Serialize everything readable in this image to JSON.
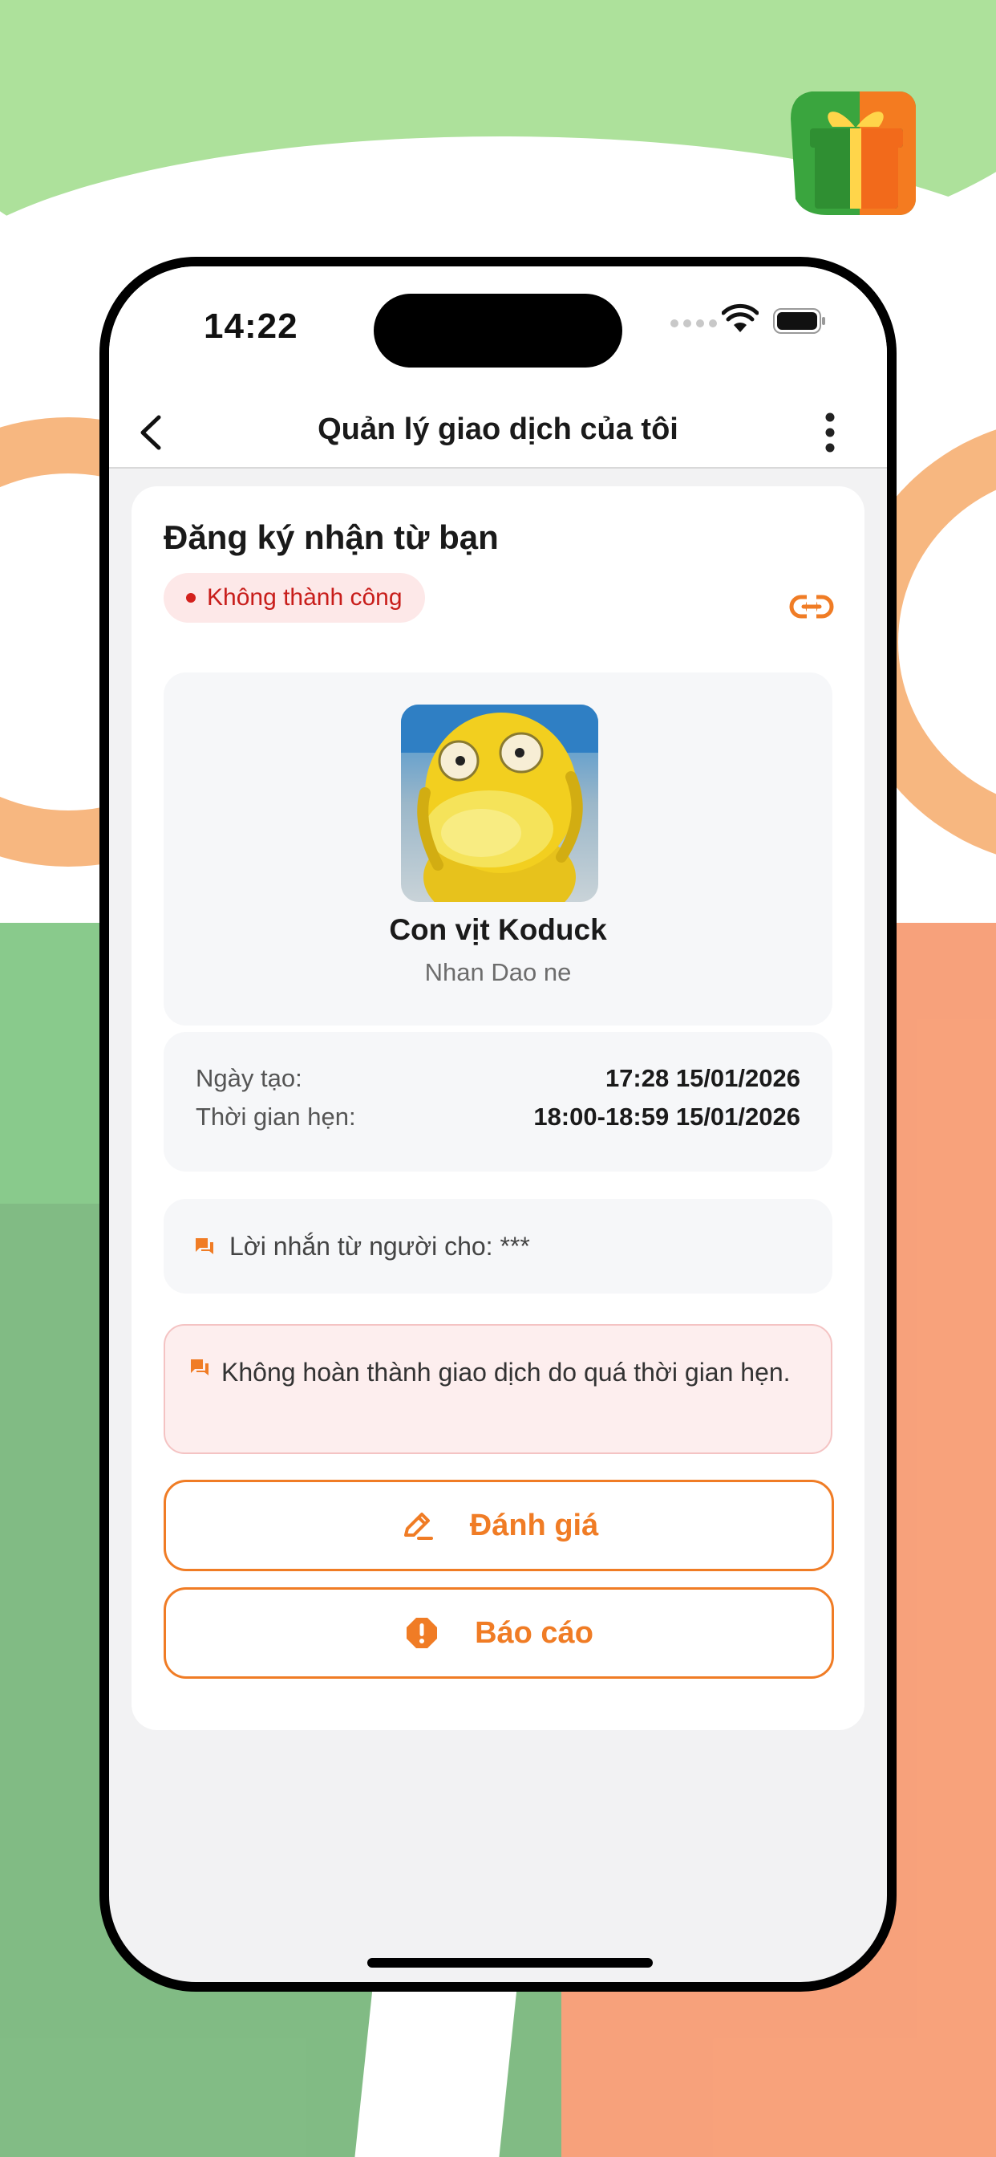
{
  "status_bar": {
    "time": "14:22"
  },
  "header": {
    "title": "Quản lý giao dịch của tôi"
  },
  "card": {
    "title": "Đăng ký nhận từ bạn",
    "status": "Không thành công"
  },
  "product": {
    "name": "Con vịt Koduck",
    "owner": "Nhan Dao ne"
  },
  "details": {
    "created_label": "Ngày tạo:",
    "created_value": "17:28 15/01/2026",
    "appointment_label": "Thời gian hẹn:",
    "appointment_value": "18:00-18:59 15/01/2026"
  },
  "giver_message": "Lời nhắn từ người cho: ***",
  "failure_note": "Không hoàn thành giao dịch do quá thời gian hẹn.",
  "actions": {
    "rate_label": "Đánh giá",
    "report_label": "Báo cáo"
  },
  "colors": {
    "accent": "#f07c25",
    "error": "#c81d1a",
    "error_bg": "#fde8e8"
  }
}
